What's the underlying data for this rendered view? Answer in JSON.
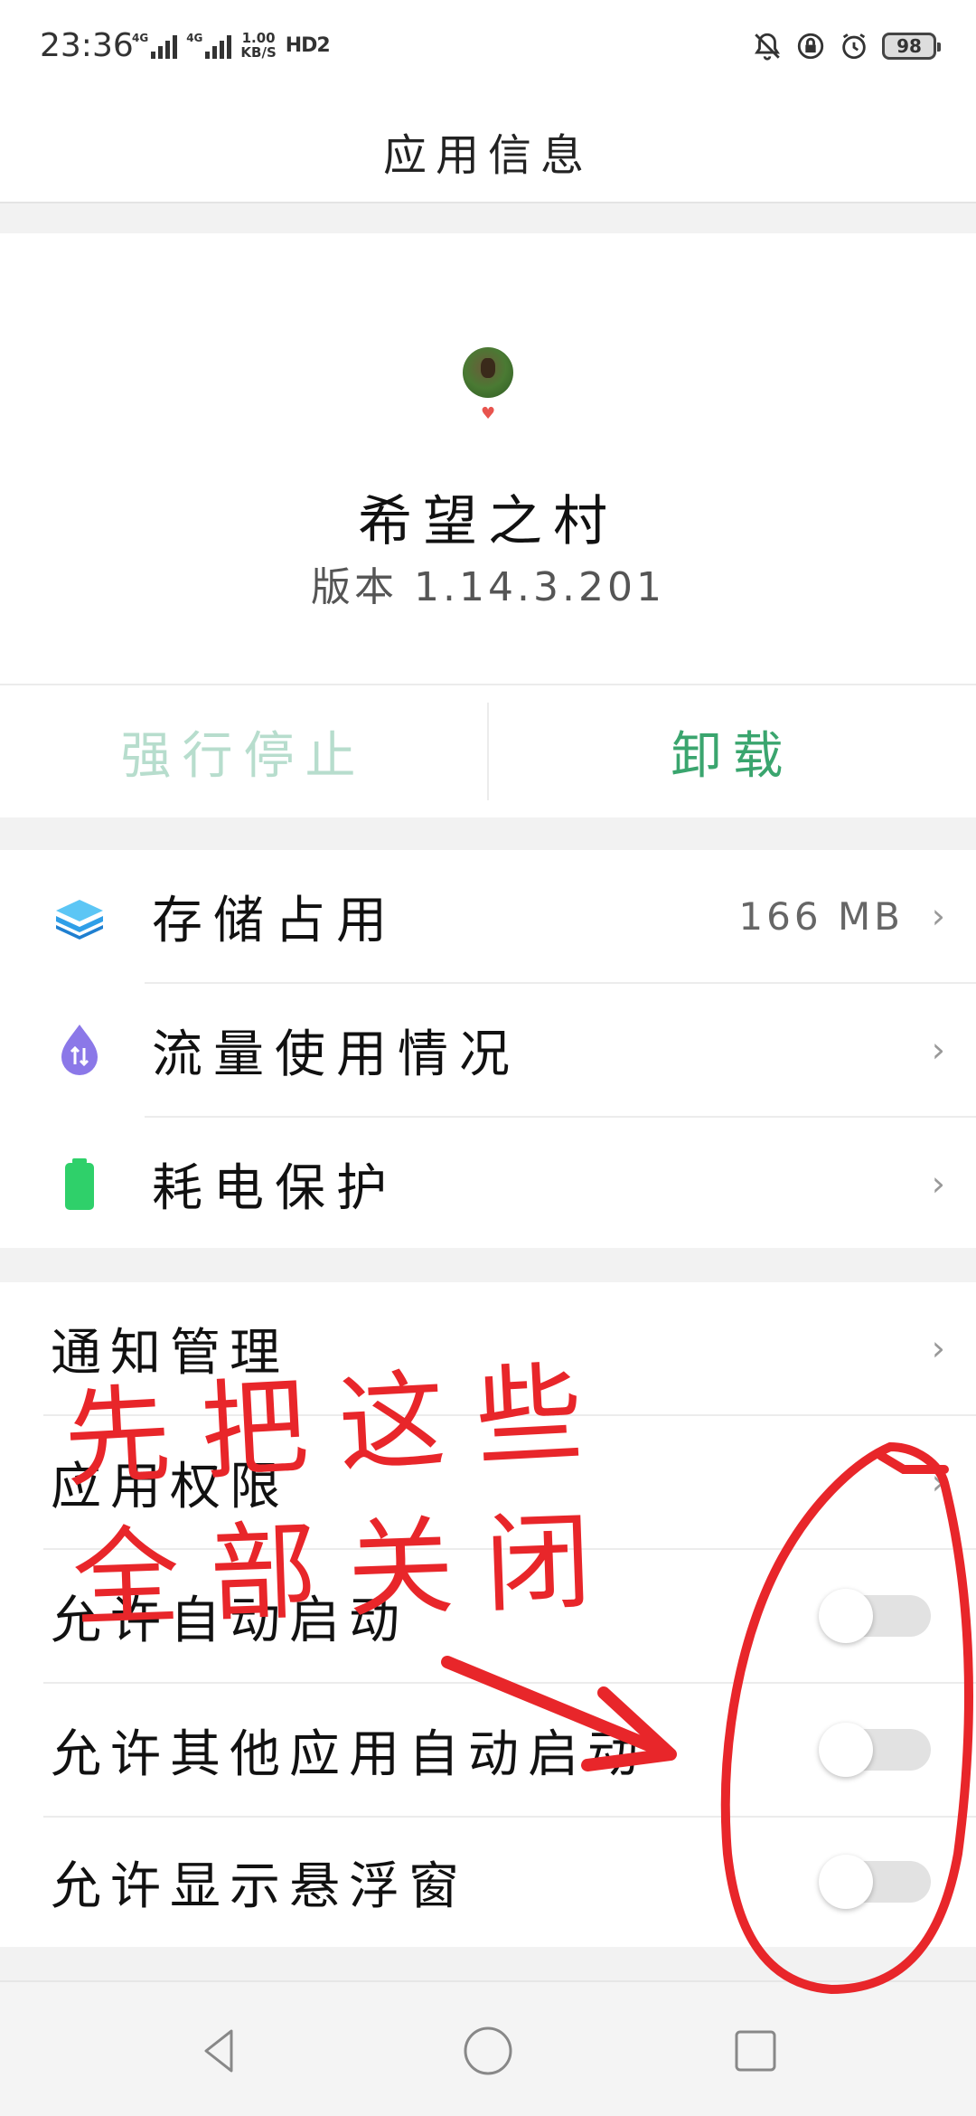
{
  "status_bar": {
    "time": "23:36",
    "net1": "4G",
    "net2": "4G",
    "speed_value": "1.00",
    "speed_unit": "KB/S",
    "hd": "HD2",
    "battery": "98"
  },
  "header": {
    "title": "应用信息"
  },
  "app": {
    "name": "希望之村",
    "version": "版本 1.14.3.201"
  },
  "actions": {
    "force_stop": "强行停止",
    "uninstall": "卸载"
  },
  "list_main": [
    {
      "label": "存储占用",
      "value": "166 MB",
      "icon": "storage-layers-icon",
      "icon_color": "#2f9fe8"
    },
    {
      "label": "流量使用情况",
      "value": "",
      "icon": "data-usage-drop-icon",
      "icon_color": "#8b78e8"
    },
    {
      "label": "耗电保护",
      "value": "",
      "icon": "battery-icon",
      "icon_color": "#2fd06a"
    }
  ],
  "list_settings": [
    {
      "label": "通知管理",
      "type": "link"
    },
    {
      "label": "应用权限",
      "type": "link"
    },
    {
      "label": "允许自动启动",
      "type": "toggle",
      "on": false
    },
    {
      "label": "允许其他应用自动启动",
      "type": "toggle",
      "on": false
    },
    {
      "label": "允许显示悬浮窗",
      "type": "toggle",
      "on": false
    }
  ],
  "annotation": {
    "line1": "先把这些",
    "line2": "全部关闭",
    "color": "#e8262a"
  },
  "colors": {
    "accent_green": "#3aa56e",
    "disabled_green": "#b7ddcd"
  }
}
